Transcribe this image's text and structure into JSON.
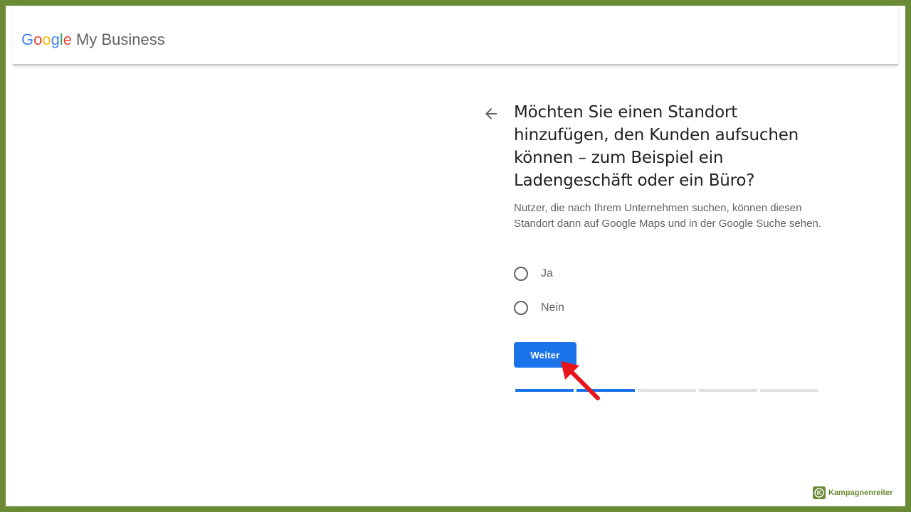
{
  "header": {
    "logo_letters": [
      {
        "char": "G",
        "color": "#4285F4"
      },
      {
        "char": "o",
        "color": "#EA4335"
      },
      {
        "char": "o",
        "color": "#FBBC05"
      },
      {
        "char": "g",
        "color": "#4285F4"
      },
      {
        "char": "l",
        "color": "#34A853"
      },
      {
        "char": "e",
        "color": "#EA4335"
      }
    ],
    "product_name": "My Business"
  },
  "form": {
    "back_icon": "arrow-left-icon",
    "question": "Möchten Sie einen Standort hinzufügen, den Kunden aufsuchen können – zum Beispiel ein Ladengeschäft oder ein Büro?",
    "description": "Nutzer, die nach Ihrem Unternehmen suchen, können diesen Standort dann auf Google Maps und in der Google Suche sehen.",
    "options": [
      {
        "label": "Ja",
        "selected": false
      },
      {
        "label": "Nein",
        "selected": false
      }
    ],
    "next_button": "Weiter",
    "progress": {
      "total_steps": 5,
      "completed_steps": 2
    }
  },
  "colors": {
    "accent": "#1a73e8",
    "frame": "#6b8a35",
    "annotation_arrow": "#e8141c"
  },
  "annotation": {
    "icon": "red-pointer-arrow-icon"
  },
  "watermark": {
    "text": "Kampagnenreiter",
    "logo_letter": "K"
  }
}
